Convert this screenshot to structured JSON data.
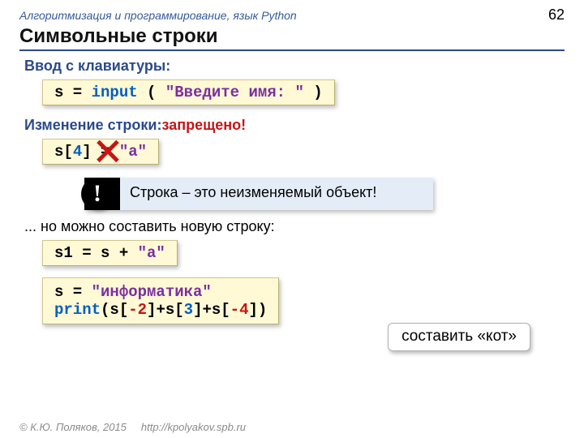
{
  "header": {
    "course": "Алгоритмизация и программирование, язык Python",
    "page": "62"
  },
  "title": "Символьные строки",
  "sec1": {
    "label": "Ввод с клавиатуры:"
  },
  "code1": {
    "a": "s = ",
    "b": "input",
    "c": " ( ",
    "d": "\"Введите имя: \"",
    "e": " )"
  },
  "sec2": {
    "label_a": "Изменение строки:",
    "label_b": "запрещено!"
  },
  "code2": {
    "a": "s[",
    "b": "4",
    "c": "] = ",
    "d": "\"a\""
  },
  "info": {
    "bang": "!",
    "text": "Строка – это неизменяемый объект!"
  },
  "sec3": {
    "label": "... но можно составить новую строку:"
  },
  "code3": {
    "a": "s1 = s + ",
    "b": "\"a\""
  },
  "callout": "составить «кот»",
  "code4": {
    "l1a": "s = ",
    "l1b": "\"информатика\"",
    "l2a": "print",
    "l2b": "(s[",
    "l2c": "-2",
    "l2d": "]+s[",
    "l2e": "3",
    "l2f": "]+s[",
    "l2g": "-4",
    "l2h": "])"
  },
  "footer": {
    "copy": "© К.Ю. Поляков, 2015",
    "url": "http://kpolyakov.spb.ru"
  }
}
